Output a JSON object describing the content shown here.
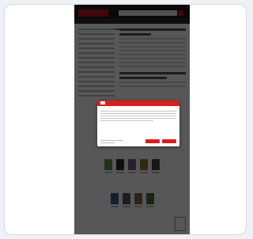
{
  "page": {
    "header": {
      "logo_text": "",
      "search_placeholder": ""
    },
    "cookie_dialog": {
      "header_text": "",
      "title": "",
      "link_text": "",
      "accept_all_label": "",
      "reject_label": "",
      "accent_color": "#d81e1e"
    },
    "sections": {
      "top_sellers": "",
      "latest_arrivals": ""
    },
    "footer_text": ""
  }
}
